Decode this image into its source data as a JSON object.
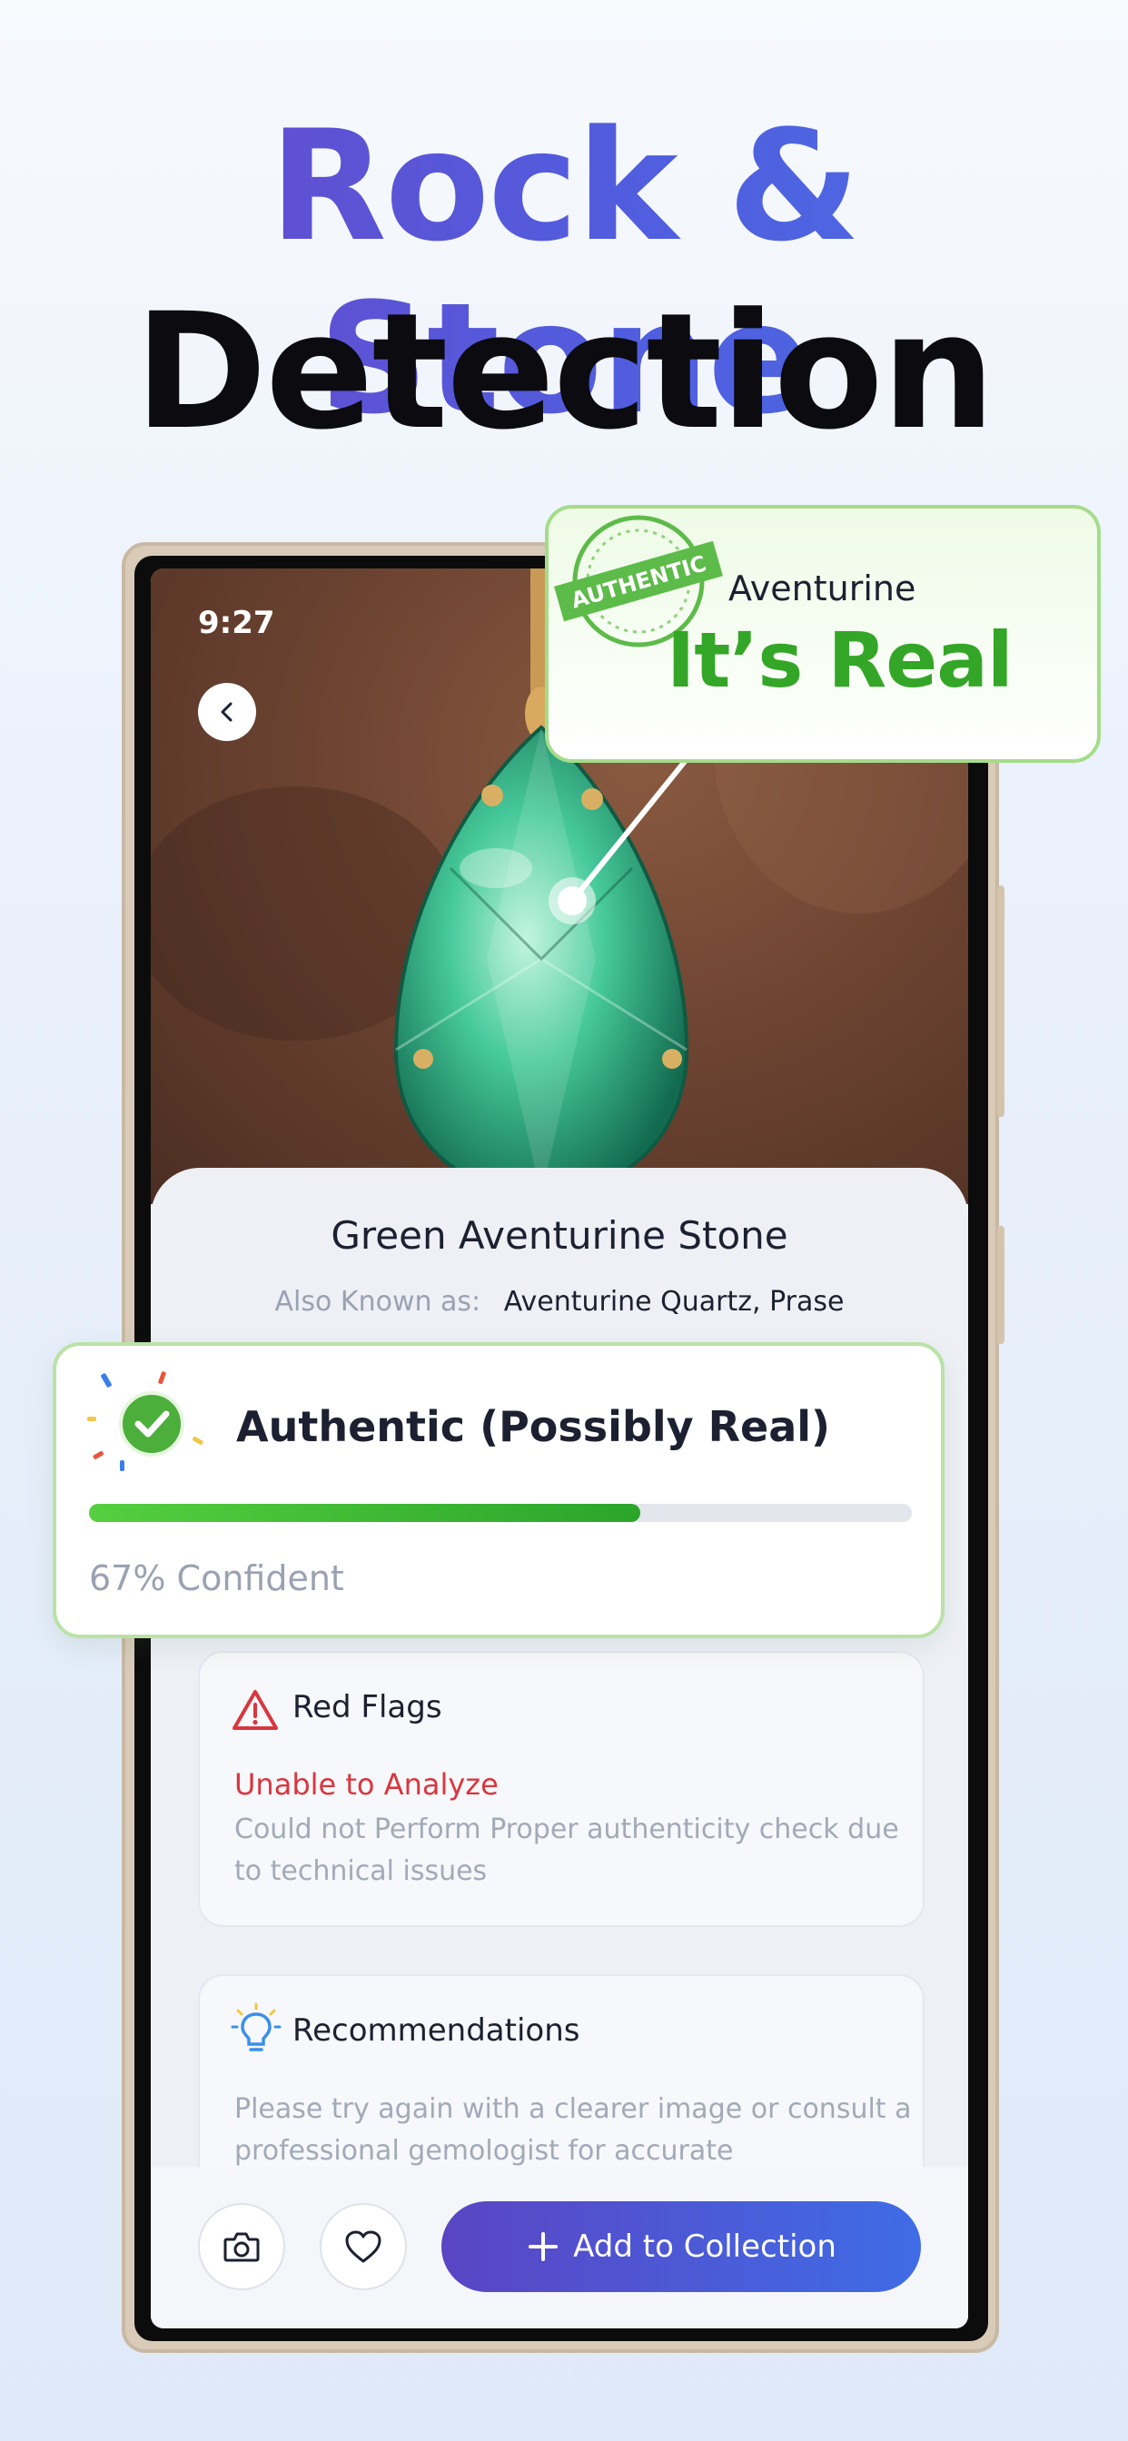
{
  "headline": {
    "line1": "Rock & Stone",
    "line2": "Detection"
  },
  "status_bar": {
    "time": "9:27"
  },
  "callout_real": {
    "stamp_text": "AUTHENTIC",
    "stone": "Aventurine",
    "verdict": "It’s Real"
  },
  "result": {
    "title": "Green Aventurine Stone",
    "aka_label": "Also Known as:",
    "aka_value": "Aventurine Quartz, Prase"
  },
  "authenticity": {
    "label": "Authentic (Possibly Real)",
    "confidence": 0.67,
    "confidence_text": "67% Confident"
  },
  "red_flags": {
    "title": "Red Flags",
    "heading": "Unable to Analyze",
    "body": "Could not Perform Proper authenticity check due to technical issues"
  },
  "recommendations": {
    "title": "Recommendations",
    "body": "Please try again with a clearer image or consult a professional gemologist for accurate"
  },
  "actions": {
    "add_label": "Add to Collection"
  },
  "colors": {
    "brand_purple": "#5a45c4",
    "brand_blue": "#3f6ce6",
    "success_green": "#34a627",
    "danger_red": "#d9363e"
  },
  "icons": [
    "chevron-left-icon",
    "authentic-stamp-icon",
    "check-circle-icon",
    "warning-icon",
    "lightbulb-icon",
    "camera-icon",
    "heart-icon",
    "plus-icon"
  ]
}
